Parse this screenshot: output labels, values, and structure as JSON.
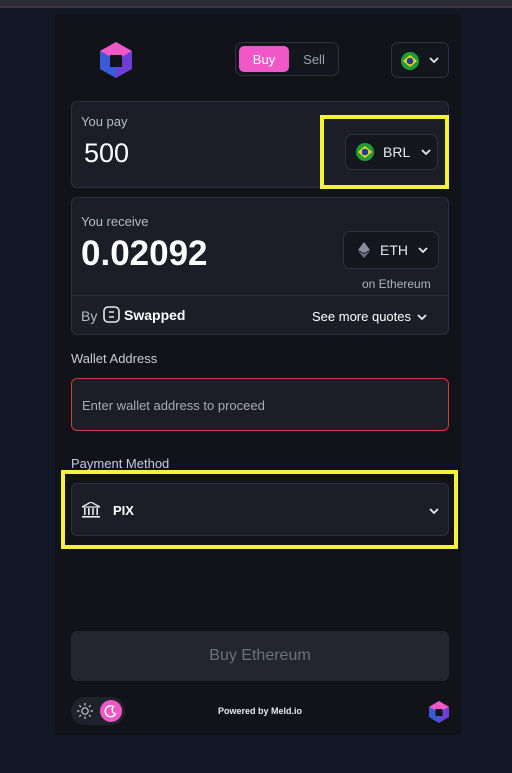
{
  "header": {
    "buy_label": "Buy",
    "sell_label": "Sell",
    "country_flag": "brazil-flag-icon"
  },
  "pay": {
    "label": "You pay",
    "amount": "500",
    "currency": "BRL"
  },
  "receive": {
    "label": "You receive",
    "amount": "0.02092",
    "currency": "ETH",
    "network": "on Ethereum",
    "by_label": "By",
    "provider": "Swapped",
    "see_more": "See more quotes"
  },
  "wallet": {
    "label": "Wallet Address",
    "placeholder": "Enter wallet address to proceed"
  },
  "payment": {
    "label": "Payment Method",
    "method": "PIX"
  },
  "cta": {
    "label": "Buy Ethereum"
  },
  "footer": {
    "powered_by": "Powered by Meld.io"
  },
  "colors": {
    "accent": "#ef58c6",
    "highlight": "#f4f23a",
    "error_border": "#d23b3b"
  }
}
